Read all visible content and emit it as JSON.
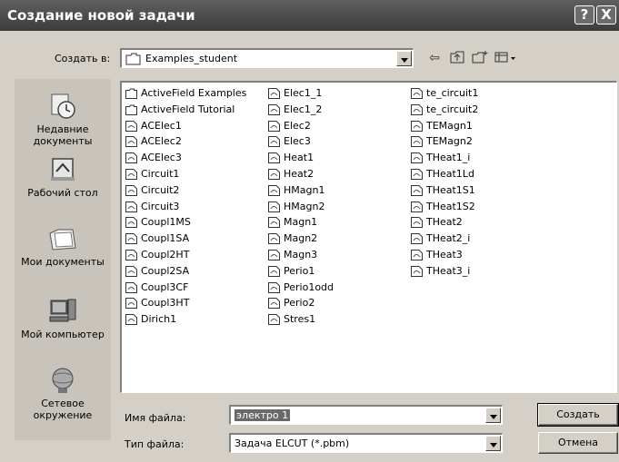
{
  "window": {
    "title": "Создание новой задачи",
    "help_label": "?",
    "close_label": "X"
  },
  "location": {
    "label": "Создать в:",
    "value": "Examples_student",
    "icons": [
      "back-icon",
      "up-folder-icon",
      "new-folder-icon",
      "view-menu-icon"
    ]
  },
  "places": [
    {
      "label": "Недавние документы",
      "icon": "recent-documents-icon"
    },
    {
      "label": "Рабочий стол",
      "icon": "desktop-icon"
    },
    {
      "label": "Мои документы",
      "icon": "my-documents-icon"
    },
    {
      "label": "Мой компьютер",
      "icon": "my-computer-icon"
    },
    {
      "label": "Сетевое окружение",
      "icon": "network-icon"
    }
  ],
  "files": {
    "col1": [
      {
        "name": "ActiveField Examples",
        "type": "folder"
      },
      {
        "name": "ActiveField Tutorial",
        "type": "folder"
      },
      {
        "name": "ACElec1",
        "type": "file"
      },
      {
        "name": "ACElec2",
        "type": "file"
      },
      {
        "name": "ACElec3",
        "type": "file"
      },
      {
        "name": "Circuit1",
        "type": "file"
      },
      {
        "name": "Circuit2",
        "type": "file"
      },
      {
        "name": "Circuit3",
        "type": "file"
      },
      {
        "name": "Coupl1MS",
        "type": "file"
      },
      {
        "name": "Coupl1SA",
        "type": "file"
      },
      {
        "name": "Coupl2HT",
        "type": "file"
      },
      {
        "name": "Coupl2SA",
        "type": "file"
      },
      {
        "name": "Coupl3CF",
        "type": "file"
      },
      {
        "name": "Coupl3HT",
        "type": "file"
      },
      {
        "name": "Dirich1",
        "type": "file"
      }
    ],
    "col2": [
      {
        "name": "Elec1_1",
        "type": "file"
      },
      {
        "name": "Elec1_2",
        "type": "file"
      },
      {
        "name": "Elec2",
        "type": "file"
      },
      {
        "name": "Elec3",
        "type": "file"
      },
      {
        "name": "Heat1",
        "type": "file"
      },
      {
        "name": "Heat2",
        "type": "file"
      },
      {
        "name": "HMagn1",
        "type": "file"
      },
      {
        "name": "HMagn2",
        "type": "file"
      },
      {
        "name": "Magn1",
        "type": "file"
      },
      {
        "name": "Magn2",
        "type": "file"
      },
      {
        "name": "Magn3",
        "type": "file"
      },
      {
        "name": "Perio1",
        "type": "file"
      },
      {
        "name": "Perio1odd",
        "type": "file"
      },
      {
        "name": "Perio2",
        "type": "file"
      },
      {
        "name": "Stres1",
        "type": "file"
      }
    ],
    "col3": [
      {
        "name": "te_circuit1",
        "type": "file"
      },
      {
        "name": "te_circuit2",
        "type": "file"
      },
      {
        "name": "TEMagn1",
        "type": "file"
      },
      {
        "name": "TEMagn2",
        "type": "file"
      },
      {
        "name": "THeat1_i",
        "type": "file"
      },
      {
        "name": "THeat1Ld",
        "type": "file"
      },
      {
        "name": "THeat1S1",
        "type": "file"
      },
      {
        "name": "THeat1S2",
        "type": "file"
      },
      {
        "name": "THeat2",
        "type": "file"
      },
      {
        "name": "THeat2_i",
        "type": "file"
      },
      {
        "name": "THeat3",
        "type": "file"
      },
      {
        "name": "THeat3_i",
        "type": "file"
      }
    ]
  },
  "filename": {
    "label": "Имя файла:",
    "value": "электро 1"
  },
  "filetype": {
    "label": "Тип файла:",
    "value": "Задача ELCUT (*.pbm)"
  },
  "buttons": {
    "create": "Создать",
    "cancel": "Отмена"
  }
}
